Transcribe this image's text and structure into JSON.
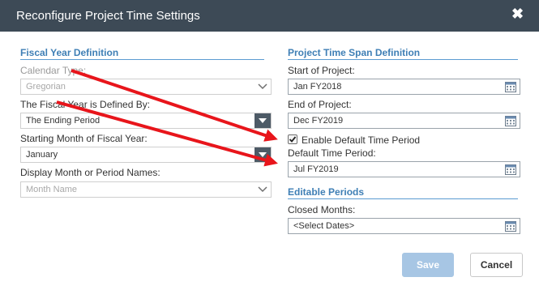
{
  "dialog": {
    "title": "Reconfigure Project Time Settings",
    "close_glyph": "✖"
  },
  "fiscal": {
    "header": "Fiscal Year Definition",
    "calendar_type_label": "Calendar Type:",
    "calendar_type_value": "Gregorian",
    "defined_by_label": "The Fiscal Year is Defined By:",
    "defined_by_value": "The Ending Period",
    "start_month_label": "Starting Month of Fiscal Year:",
    "start_month_value": "January",
    "display_label": "Display Month or Period Names:",
    "display_value": "Month Name"
  },
  "timespan": {
    "header": "Project Time Span Definition",
    "start_label": "Start of Project:",
    "start_value": "Jan FY2018",
    "end_label": "End of Project:",
    "end_value": "Dec FY2019",
    "enable_default_label": "Enable Default Time Period",
    "enable_default_checked": true,
    "default_period_label": "Default Time Period:",
    "default_period_value": "Jul FY2019"
  },
  "editable": {
    "header": "Editable Periods",
    "closed_months_label": "Closed Months:",
    "closed_months_value": "<Select Dates>"
  },
  "footer": {
    "save_label": "Save",
    "cancel_label": "Cancel"
  },
  "colors": {
    "titlebar": "#3d4a56",
    "section_header": "#3f7fb5",
    "annotation_arrow": "#e8151b",
    "save_button": "#a7c6e4"
  }
}
